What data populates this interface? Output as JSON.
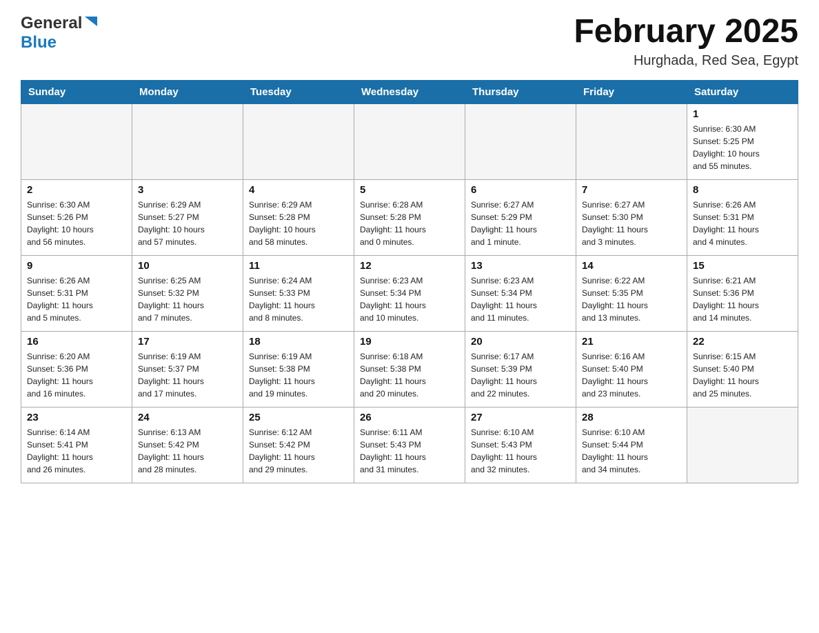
{
  "header": {
    "month_title": "February 2025",
    "location": "Hurghada, Red Sea, Egypt",
    "logo_general": "General",
    "logo_blue": "Blue"
  },
  "weekdays": [
    "Sunday",
    "Monday",
    "Tuesday",
    "Wednesday",
    "Thursday",
    "Friday",
    "Saturday"
  ],
  "weeks": [
    [
      {
        "day": "",
        "info": ""
      },
      {
        "day": "",
        "info": ""
      },
      {
        "day": "",
        "info": ""
      },
      {
        "day": "",
        "info": ""
      },
      {
        "day": "",
        "info": ""
      },
      {
        "day": "",
        "info": ""
      },
      {
        "day": "1",
        "info": "Sunrise: 6:30 AM\nSunset: 5:25 PM\nDaylight: 10 hours\nand 55 minutes."
      }
    ],
    [
      {
        "day": "2",
        "info": "Sunrise: 6:30 AM\nSunset: 5:26 PM\nDaylight: 10 hours\nand 56 minutes."
      },
      {
        "day": "3",
        "info": "Sunrise: 6:29 AM\nSunset: 5:27 PM\nDaylight: 10 hours\nand 57 minutes."
      },
      {
        "day": "4",
        "info": "Sunrise: 6:29 AM\nSunset: 5:28 PM\nDaylight: 10 hours\nand 58 minutes."
      },
      {
        "day": "5",
        "info": "Sunrise: 6:28 AM\nSunset: 5:28 PM\nDaylight: 11 hours\nand 0 minutes."
      },
      {
        "day": "6",
        "info": "Sunrise: 6:27 AM\nSunset: 5:29 PM\nDaylight: 11 hours\nand 1 minute."
      },
      {
        "day": "7",
        "info": "Sunrise: 6:27 AM\nSunset: 5:30 PM\nDaylight: 11 hours\nand 3 minutes."
      },
      {
        "day": "8",
        "info": "Sunrise: 6:26 AM\nSunset: 5:31 PM\nDaylight: 11 hours\nand 4 minutes."
      }
    ],
    [
      {
        "day": "9",
        "info": "Sunrise: 6:26 AM\nSunset: 5:31 PM\nDaylight: 11 hours\nand 5 minutes."
      },
      {
        "day": "10",
        "info": "Sunrise: 6:25 AM\nSunset: 5:32 PM\nDaylight: 11 hours\nand 7 minutes."
      },
      {
        "day": "11",
        "info": "Sunrise: 6:24 AM\nSunset: 5:33 PM\nDaylight: 11 hours\nand 8 minutes."
      },
      {
        "day": "12",
        "info": "Sunrise: 6:23 AM\nSunset: 5:34 PM\nDaylight: 11 hours\nand 10 minutes."
      },
      {
        "day": "13",
        "info": "Sunrise: 6:23 AM\nSunset: 5:34 PM\nDaylight: 11 hours\nand 11 minutes."
      },
      {
        "day": "14",
        "info": "Sunrise: 6:22 AM\nSunset: 5:35 PM\nDaylight: 11 hours\nand 13 minutes."
      },
      {
        "day": "15",
        "info": "Sunrise: 6:21 AM\nSunset: 5:36 PM\nDaylight: 11 hours\nand 14 minutes."
      }
    ],
    [
      {
        "day": "16",
        "info": "Sunrise: 6:20 AM\nSunset: 5:36 PM\nDaylight: 11 hours\nand 16 minutes."
      },
      {
        "day": "17",
        "info": "Sunrise: 6:19 AM\nSunset: 5:37 PM\nDaylight: 11 hours\nand 17 minutes."
      },
      {
        "day": "18",
        "info": "Sunrise: 6:19 AM\nSunset: 5:38 PM\nDaylight: 11 hours\nand 19 minutes."
      },
      {
        "day": "19",
        "info": "Sunrise: 6:18 AM\nSunset: 5:38 PM\nDaylight: 11 hours\nand 20 minutes."
      },
      {
        "day": "20",
        "info": "Sunrise: 6:17 AM\nSunset: 5:39 PM\nDaylight: 11 hours\nand 22 minutes."
      },
      {
        "day": "21",
        "info": "Sunrise: 6:16 AM\nSunset: 5:40 PM\nDaylight: 11 hours\nand 23 minutes."
      },
      {
        "day": "22",
        "info": "Sunrise: 6:15 AM\nSunset: 5:40 PM\nDaylight: 11 hours\nand 25 minutes."
      }
    ],
    [
      {
        "day": "23",
        "info": "Sunrise: 6:14 AM\nSunset: 5:41 PM\nDaylight: 11 hours\nand 26 minutes."
      },
      {
        "day": "24",
        "info": "Sunrise: 6:13 AM\nSunset: 5:42 PM\nDaylight: 11 hours\nand 28 minutes."
      },
      {
        "day": "25",
        "info": "Sunrise: 6:12 AM\nSunset: 5:42 PM\nDaylight: 11 hours\nand 29 minutes."
      },
      {
        "day": "26",
        "info": "Sunrise: 6:11 AM\nSunset: 5:43 PM\nDaylight: 11 hours\nand 31 minutes."
      },
      {
        "day": "27",
        "info": "Sunrise: 6:10 AM\nSunset: 5:43 PM\nDaylight: 11 hours\nand 32 minutes."
      },
      {
        "day": "28",
        "info": "Sunrise: 6:10 AM\nSunset: 5:44 PM\nDaylight: 11 hours\nand 34 minutes."
      },
      {
        "day": "",
        "info": ""
      }
    ]
  ]
}
